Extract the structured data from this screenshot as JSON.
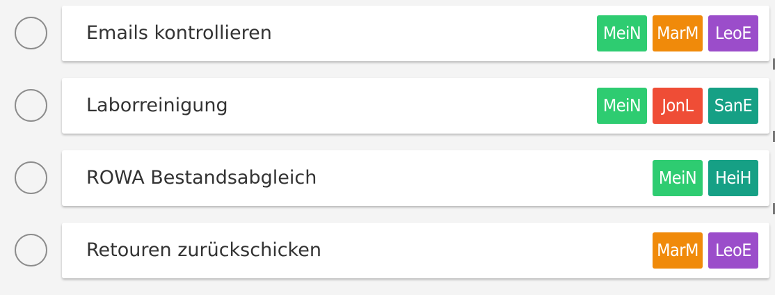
{
  "colors": {
    "MeiN": "#2ecc71",
    "MarM": "#f08a0a",
    "LeoE": "#9b4dca",
    "JonL": "#ef4d36",
    "SanE": "#16a085",
    "HeiH": "#16a085"
  },
  "tasks": [
    {
      "title": "Emails kontrollieren",
      "tags": [
        "MeiN",
        "MarM",
        "LeoE"
      ]
    },
    {
      "title": "Laborreinigung",
      "tags": [
        "MeiN",
        "JonL",
        "SanE"
      ]
    },
    {
      "title": "ROWA Bestandsabgleich",
      "tags": [
        "MeiN",
        "HeiH"
      ]
    },
    {
      "title": "Retouren zurückschicken",
      "tags": [
        "MarM",
        "LeoE"
      ]
    }
  ]
}
